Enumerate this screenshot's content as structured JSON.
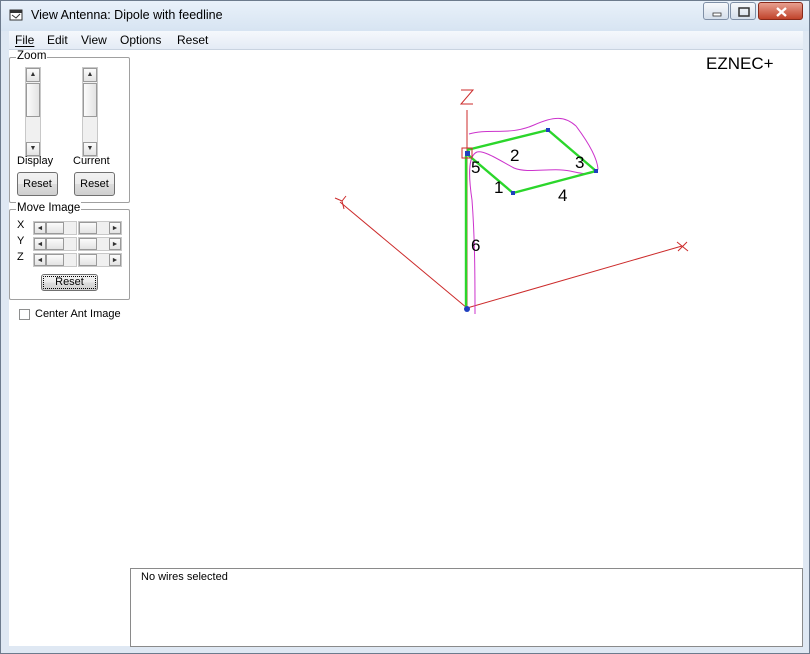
{
  "window": {
    "title": "View Antenna: Dipole with feedline",
    "app_icon": "eznec-window-icon"
  },
  "caption_buttons": {
    "minimize_icon": "minimize-icon",
    "maximize_icon": "maximize-icon",
    "close_icon": "close-icon"
  },
  "menu": {
    "items": [
      "File",
      "Edit",
      "View",
      "Options",
      "Reset"
    ]
  },
  "zoom": {
    "group_label": "Zoom",
    "display_label": "Display",
    "current_label": "Current",
    "display_reset": "Reset",
    "current_reset": "Reset"
  },
  "move_image": {
    "group_label": "Move Image",
    "axes": [
      "X",
      "Y",
      "Z"
    ],
    "reset_label": "Reset"
  },
  "center_ant_image": {
    "label": "Center Ant Image",
    "checked": false
  },
  "brand": "EZNEC+",
  "view": {
    "axis_labels": [
      "Z",
      "Y",
      "X"
    ],
    "wire_labels": [
      "1",
      "2",
      "3",
      "4",
      "5",
      "6"
    ],
    "colors": {
      "axis": "#cc2b2b",
      "wire": "#2bd62b",
      "pattern": "#cc33cc",
      "node": "#1f3fbf",
      "source": "#cc2b2b"
    }
  },
  "status": {
    "text": "No wires selected"
  }
}
